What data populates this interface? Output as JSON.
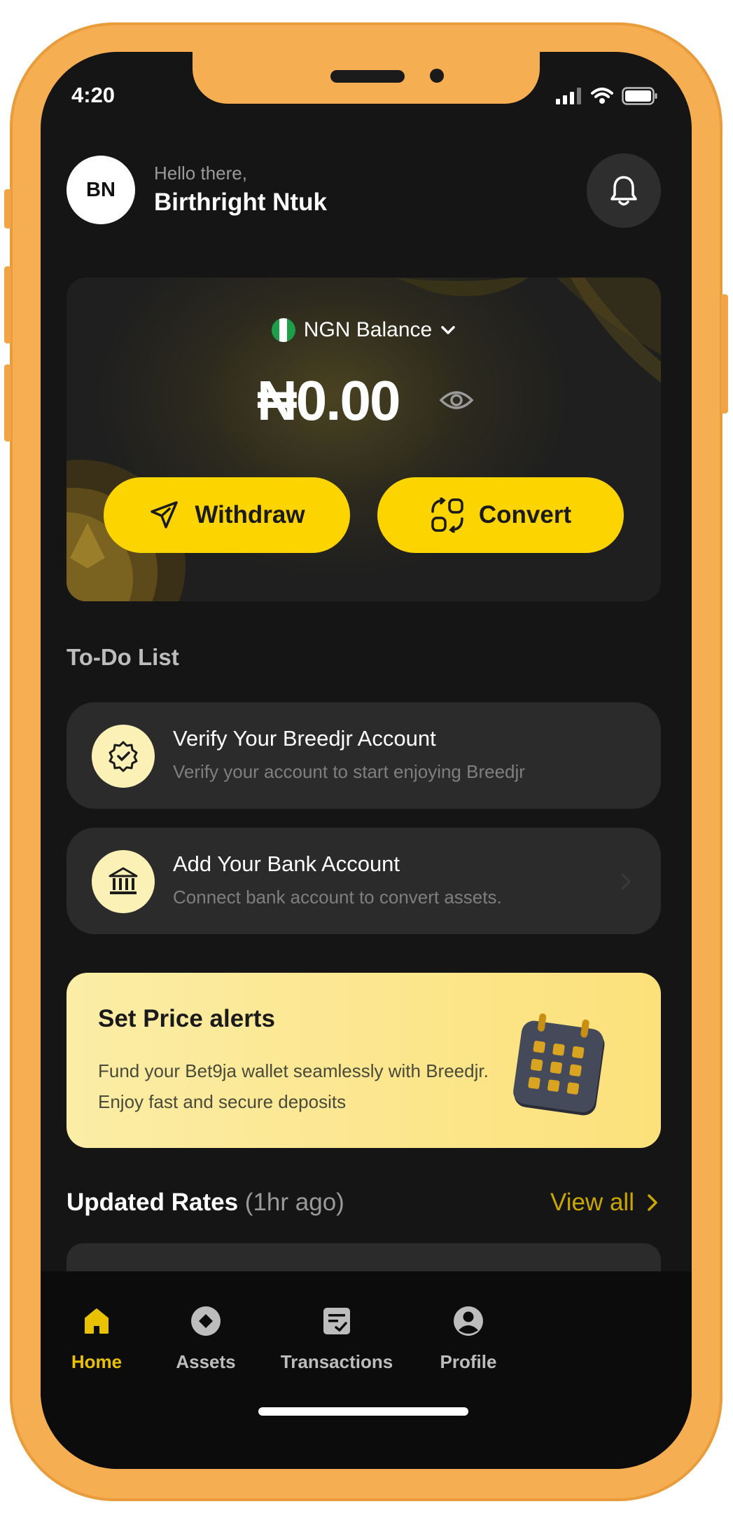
{
  "status_bar": {
    "time": "4:20"
  },
  "header": {
    "avatar_initials": "BN",
    "greeting": "Hello there,",
    "user_name": "Birthright Ntuk"
  },
  "balance": {
    "currency_label": "NGN Balance",
    "amount": "₦0.00",
    "withdraw_label": "Withdraw",
    "convert_label": "Convert"
  },
  "todo": {
    "section_title": "To-Do List",
    "items": [
      {
        "title": "Verify Your Breedjr Account",
        "subtitle": "Verify your account to start enjoying Breedjr",
        "icon": "verified-badge-icon"
      },
      {
        "title": "Add Your Bank Account",
        "subtitle": "Connect bank account to convert assets.",
        "icon": "bank-icon"
      }
    ]
  },
  "promo": {
    "title": "Set Price alerts",
    "body": "Fund your Bet9ja wallet seamlessly with Breedjr. Enjoy fast and secure deposits"
  },
  "rates": {
    "title": "Updated Rates",
    "subtitle": "(1hr ago)",
    "view_all": "View all"
  },
  "tabs": [
    {
      "label": "Home",
      "active": true
    },
    {
      "label": "Assets",
      "active": false
    },
    {
      "label": "Transactions",
      "active": false
    },
    {
      "label": "Profile",
      "active": false
    }
  ],
  "colors": {
    "accent_yellow": "#FCD500",
    "frame_orange": "#F5AE52",
    "background": "#151515"
  }
}
